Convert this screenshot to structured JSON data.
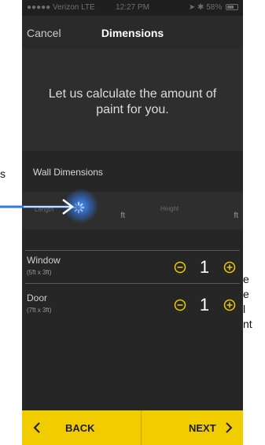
{
  "status_bar": {
    "carrier": "●●●●● Verizon  LTE",
    "time": "12:27 PM",
    "battery": "58%"
  },
  "nav": {
    "cancel_label": "Cancel",
    "title": "Dimensions"
  },
  "hero": {
    "message": "Let us calculate the amount of paint for you."
  },
  "wall_dimensions": {
    "section_label": "Wall Dimensions",
    "length_label": "Length",
    "height_label": "Height",
    "unit": "ft"
  },
  "openings": [
    {
      "title": "Window",
      "size": "(5ft x 3ft)",
      "count": "1"
    },
    {
      "title": "Door",
      "size": "(7ft x 3ft)",
      "count": "1"
    }
  ],
  "footer": {
    "back_label": "BACK",
    "next_label": "NEXT"
  },
  "background_text": {
    "left_fragment": "s",
    "right_fragments": [
      "e",
      "e",
      "l",
      "nt"
    ]
  },
  "colors": {
    "accent_yellow": "#f1cc00",
    "background_dark": "#262626",
    "annotation_blue": "#2f78e6"
  }
}
